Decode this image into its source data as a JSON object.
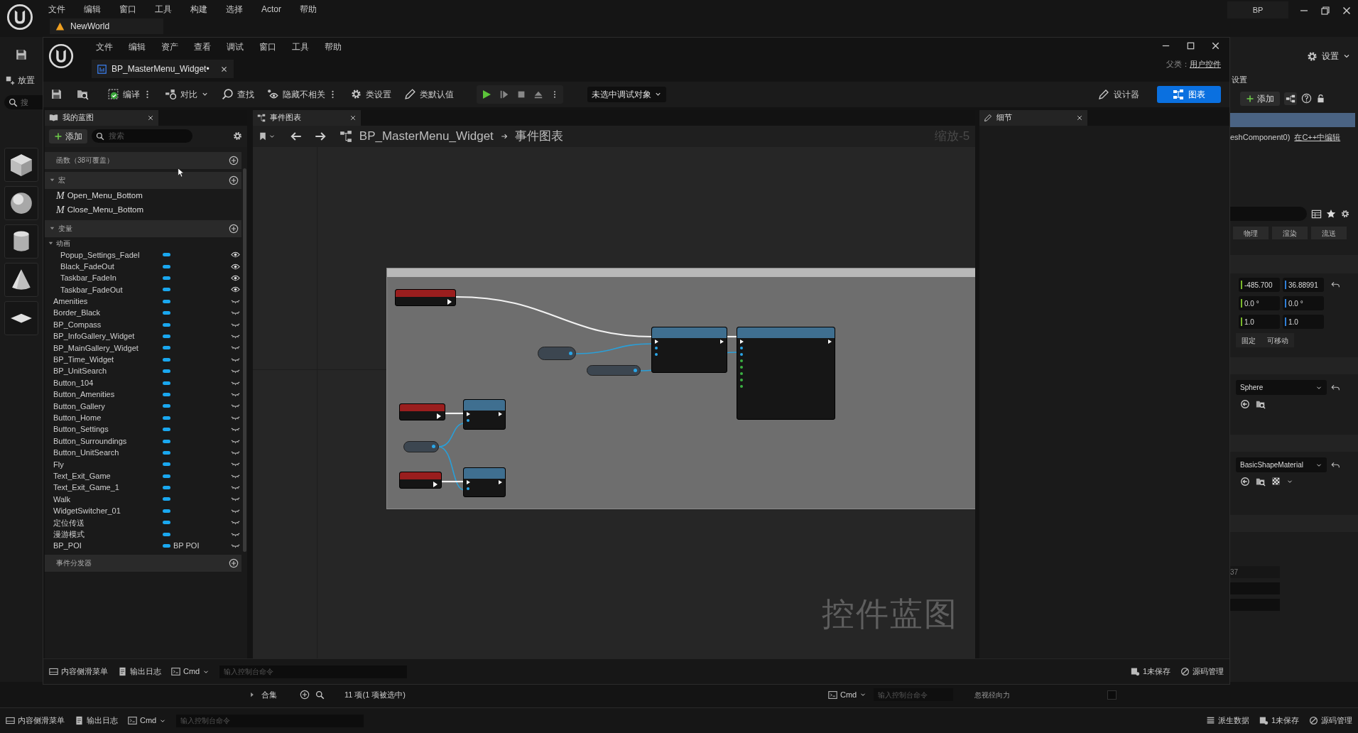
{
  "outer_menu": [
    "文件",
    "编辑",
    "窗口",
    "工具",
    "构建",
    "选择",
    "Actor",
    "帮助"
  ],
  "level_tab": "NewWorld",
  "project_label": "BP",
  "place_label": "放置",
  "outer_search_placeholder": "搜",
  "bp_window": {
    "menu": [
      "文件",
      "编辑",
      "资产",
      "查看",
      "调试",
      "窗口",
      "工具",
      "帮助"
    ],
    "tab": "BP_MasterMenu_Widget•",
    "parent_label": "父类：",
    "parent_link": "用户控件",
    "toolbar": [
      "编译",
      "对比",
      "查找",
      "隐藏不相关",
      "类设置",
      "类默认值"
    ],
    "debug_dropdown": "未选中调试对象",
    "modes": [
      {
        "label": "设计器",
        "selected": false
      },
      {
        "label": "图表",
        "selected": true
      }
    ],
    "my_blueprint": {
      "title": "我的蓝图",
      "add": "添加",
      "search_placeholder": "搜索",
      "functions": "函数（38可覆盖）",
      "macros": {
        "label": "宏",
        "expanded": true,
        "items": [
          {
            "icon": "M",
            "name": "Open_Menu_Bottom"
          },
          {
            "icon": "M",
            "name": "Close_Menu_Bottom"
          }
        ]
      },
      "variables": {
        "label": "变量",
        "expanded": true,
        "groups": [
          {
            "label": "动画",
            "expanded": true,
            "items": [
              {
                "name": "Popup_Settings_FadeI",
                "visible": true
              },
              {
                "name": "Black_FadeOut",
                "visible": true
              },
              {
                "name": "Taskbar_FadeIn",
                "visible": true
              },
              {
                "name": "Taskbar_FadeOut",
                "visible": true
              }
            ]
          }
        ],
        "items": [
          {
            "name": "Amenities",
            "visible": false
          },
          {
            "name": "Border_Black",
            "visible": false
          },
          {
            "name": "BP_Compass",
            "visible": false
          },
          {
            "name": "BP_InfoGallery_Widget",
            "visible": false
          },
          {
            "name": "BP_MainGallery_Widget",
            "visible": false
          },
          {
            "name": "BP_Time_Widget",
            "visible": false
          },
          {
            "name": "BP_UnitSearch",
            "visible": false
          },
          {
            "name": "Button_104",
            "visible": false
          },
          {
            "name": "Button_Amenities",
            "visible": false
          },
          {
            "name": "Button_Gallery",
            "visible": false
          },
          {
            "name": "Button_Home",
            "visible": false
          },
          {
            "name": "Button_Settings",
            "visible": false
          },
          {
            "name": "Button_Surroundings",
            "visible": false
          },
          {
            "name": "Button_UnitSearch",
            "visible": false
          },
          {
            "name": "Fly",
            "visible": false
          },
          {
            "name": "Text_Exit_Game",
            "visible": false
          },
          {
            "name": "Text_Exit_Game_1",
            "visible": false
          },
          {
            "name": "Walk",
            "visible": false
          },
          {
            "name": "WidgetSwitcher_01",
            "visible": false
          },
          {
            "name": "定位传送",
            "visible": false
          },
          {
            "name": "漫游模式",
            "visible": false
          },
          {
            "name": "BP_POI",
            "visible": false,
            "type_label": "BP POI"
          }
        ]
      },
      "event_dispatchers": "事件分发器"
    },
    "graph": {
      "tab": "事件图表",
      "breadcrumb": [
        "BP_MasterMenu_Widget",
        "事件图表"
      ],
      "zoom": "缩放-5",
      "graph_type_label": "控件蓝图",
      "nodes": [
        {
          "kind": "event"
        },
        {
          "kind": "function"
        },
        {
          "kind": "function"
        },
        {
          "kind": "getter"
        },
        {
          "kind": "getter"
        },
        {
          "kind": "event"
        },
        {
          "kind": "function"
        },
        {
          "kind": "getter"
        },
        {
          "kind": "event"
        },
        {
          "kind": "function"
        }
      ]
    },
    "details": {
      "tab": "细节"
    },
    "status_bar": {
      "content_drawer": "内容侧滑菜单",
      "output_log": "输出日志",
      "cmd": "Cmd",
      "console_placeholder": "输入控制台命令",
      "unsaved": "1未保存",
      "source_control": "源码管理"
    }
  },
  "details_panel": {
    "settings": "设置",
    "title": "设置",
    "add": "添加",
    "component_text": "eshComponent0)",
    "edit_link": "在C++中编辑",
    "tabs": [
      "物理",
      "渲染",
      "流送"
    ],
    "location": [
      "-485.700",
      "36.88991"
    ],
    "rotation": [
      "0.0 °",
      "0.0 °"
    ],
    "scale": [
      "1.0",
      "1.0"
    ],
    "mobility": [
      "固定",
      "可移动"
    ],
    "mesh": "Sphere",
    "material": "BasicShapeMaterial",
    "field_value": "37"
  },
  "outliner_footer": {
    "collection": "合集",
    "count": "11 项(1 项被选中)"
  },
  "outer_console": {
    "cmd": "Cmd",
    "placeholder": "输入控制台命令"
  },
  "physics_row": {
    "label": "忽视径向力",
    "checked": false
  },
  "outer_status_bar": {
    "content_drawer": "内容侧滑菜单",
    "output_log": "输出日志",
    "cmd": "Cmd",
    "console_placeholder": "输入控制台命令",
    "derived_data": "派生数据",
    "unsaved": "1未保存",
    "source_control": "源码管理"
  }
}
